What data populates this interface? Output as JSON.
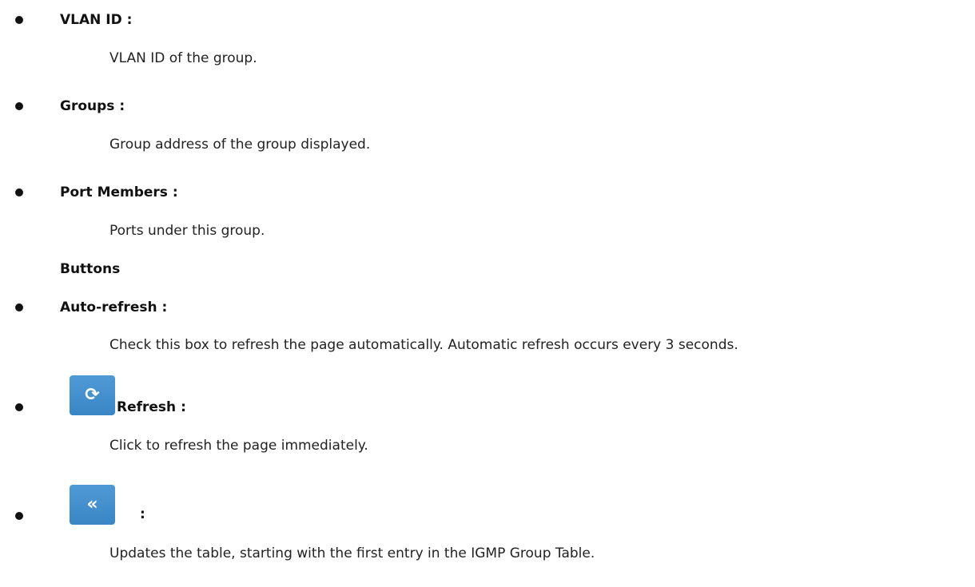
{
  "entries": [
    {
      "term": "VLAN ID :",
      "desc": "VLAN ID of the group."
    },
    {
      "term": "Groups :",
      "desc": "Group address of the group displayed."
    },
    {
      "term": "Port Members :",
      "desc": "Ports under this group."
    },
    {
      "term": "Auto-refresh :",
      "desc": "Check this box to refresh the page automatically. Automatic refresh occurs every 3 seconds."
    },
    {
      "term": "Refresh :",
      "desc": "Click to refresh the page immediately."
    },
    {
      "term": ":",
      "desc": "Updates the table, starting with the first entry in the IGMP Group Table."
    }
  ],
  "section_heading": "Buttons",
  "icons": {
    "refresh": {
      "name": "refresh-icon",
      "glyph": "⟳"
    },
    "first_page": {
      "name": "double-chevron-left-icon",
      "glyph": "«"
    }
  },
  "colors": {
    "button_blue": "#428bca",
    "text": "#222222"
  }
}
